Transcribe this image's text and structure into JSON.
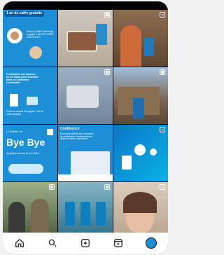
{
  "grid": {
    "tile1": {
      "badge": "1 an de cafés gratuits",
      "body": "Bravo à Emilie Parent qui a gagné 1 AN DE CAFÉS GRATUITS!!!"
    },
    "tile4": {
      "text": "Commande une boisson ou un repas pour emporter dans un contenant réutilisable!",
      "footer": "Cours la chance de gagner 1 an de cafés gratuits!"
    },
    "tile7": {
      "small": "Le Québec dit",
      "title": "Bye Bye",
      "sub": "au jetable du 5 au 11 juin 2023."
    },
    "tile8": {
      "title": "Conférence",
      "text": "Écoresponsabilité des entreprises de restauration: barrières terrain, idées et mise en application"
    }
  },
  "nav": {
    "items": [
      {
        "name": "home-icon"
      },
      {
        "name": "search-icon"
      },
      {
        "name": "create-icon"
      },
      {
        "name": "reels-icon"
      },
      {
        "name": "profile-avatar"
      }
    ]
  },
  "colors": {
    "brand_blue": "#1d8fd6",
    "dark_blue": "#0a5fa3"
  }
}
